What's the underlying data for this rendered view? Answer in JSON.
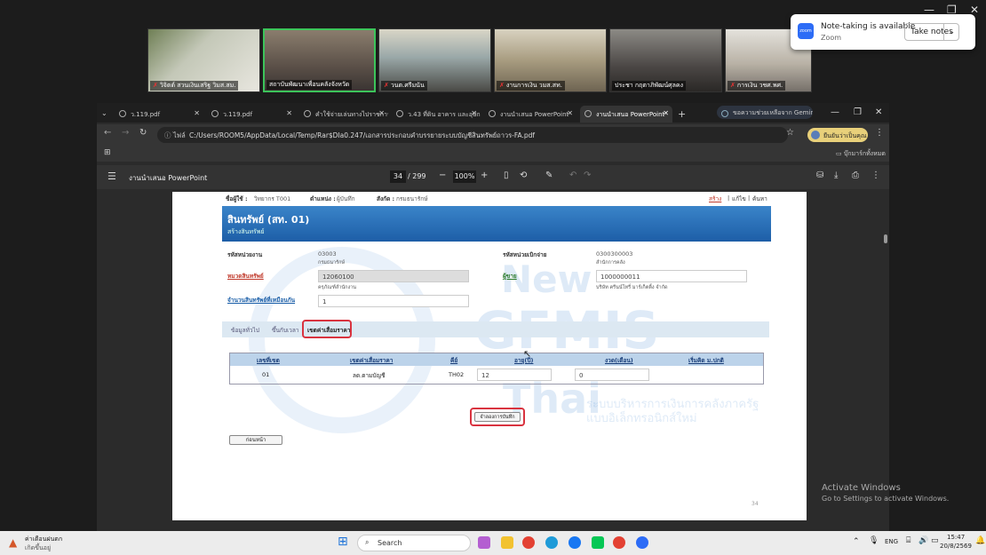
{
  "zoom": {
    "participants": [
      "วิจิตต์ สวนเงินเสริฐ วิมส.สม.",
      "สถาบันพัฒนาเพื่อนคลังจังหวัด",
      "วนต.ศรีมนัน",
      "งานการเงิน วมส.สท.",
      "ประชา กฤตาภิพัฒน์ศุลคง",
      "การเงิน วชศ.พศ."
    ],
    "toast": {
      "title": "Note-taking is available",
      "subtitle": "Zoom",
      "button": "Take notes",
      "chevron": "⌄",
      "app_label": "zoom"
    }
  },
  "browser": {
    "tabs": [
      "ว.119.pdf",
      "ว.119.pdf",
      "คำใช้จ่ายเล่นทางไปราชการ",
      "ว.43 ที่ดิน อาคาร และอุปกรณ์",
      "งานนำเสนอ PowerPoint",
      "งานนำเสนอ PowerPoint"
    ],
    "gemini": "ขอความช่วยเหลือจาก Gemini",
    "url_prefix": "ไฟล์",
    "url": "C:/Users/ROOM5/AppData/Local/Temp/Rar$DIa0.247/เอกสารประกอบคำบรรยายระบบบัญชีสินทรัพย์ถาวร-FA.pdf",
    "profile": "ยืนยันว่าเป็นคุณ",
    "bookmarks": "บุ๊กมาร์กทั้งหมด"
  },
  "pdf": {
    "title": "งานนำเสนอ PowerPoint",
    "page": "34",
    "total": "/ 299",
    "zoom": "100%",
    "minus": "−",
    "plus": "+",
    "page_no": "34"
  },
  "doc": {
    "user_label": "ชื่อผู้ใช้ :",
    "user": "วิทยากร T001",
    "pos_label": "ตำแหน่ง :",
    "pos": "ผู้บันทึก",
    "dept_label": "สังกัด :",
    "dept": "กรมธนารักษ์",
    "links": [
      "สร้าง",
      "แก้ไข",
      "ค้นหา"
    ],
    "title": "สินทรัพย์ (สท. 01)",
    "subtitle": "สร้างสินทรัพย์",
    "f_unit_l": "รหัสหน่วยงาน",
    "f_unit": "03003",
    "f_unit_n": "กรมธนารักษ์",
    "f_pay_l": "รหัสหน่วยเบิกจ่าย",
    "f_pay": "0300300003",
    "f_pay_n": "สำนักการคลัง",
    "f_cat_l": "หมวดสินทรัพย์",
    "f_cat": "12060100",
    "f_cat_n": "ครุภัณฑ์สำนักงาน",
    "f_vendor_l": "ผู้ขาย",
    "f_vendor": "1000000011",
    "f_vendor_n": "บริษัท ครีนน์โทรี่ มาร์เก็ตติ้ง จำกัด",
    "f_qty_l": "จำนวนสินทรัพย์ที่เหมือนกัน",
    "f_qty": "1",
    "tabs": [
      "ข้อมูลทั่วไป",
      "ขึ้นกับเวลา",
      "เขตค่าเสื่อมราคา"
    ],
    "table_headers": [
      "เลขที่เขต",
      "เขตค่าเสื่อมราคา",
      "คีย์",
      "อายุ(ปี)",
      "งวด(เดือน)",
      "เริ่มคิด ม.ปกติ"
    ],
    "row": [
      "01",
      "ลด.ตามบัญชี",
      "TH02",
      "12",
      "0",
      ""
    ],
    "save_btn": "จำลองการบันทึก",
    "back_btn": "ก่อนหน้า",
    "watermark_new": "New",
    "watermark_gfmis": "GFMIS",
    "watermark_thai": "Thai",
    "watermark_line1": "ระบบบริหารการเงินการคลังภาครัฐ",
    "watermark_line2": "แบบอิเล็กทรอนิกส์ใหม่"
  },
  "windows": {
    "activate1": "Activate Windows",
    "activate2": "Go to Settings to activate Windows."
  },
  "taskbar": {
    "weather1": "ค่าเตือนฝนตก",
    "weather2": "เกิดขึ้นอยู่",
    "search": "Search",
    "lang": "ENG",
    "time": "15:47",
    "date": "20/8/2569"
  }
}
